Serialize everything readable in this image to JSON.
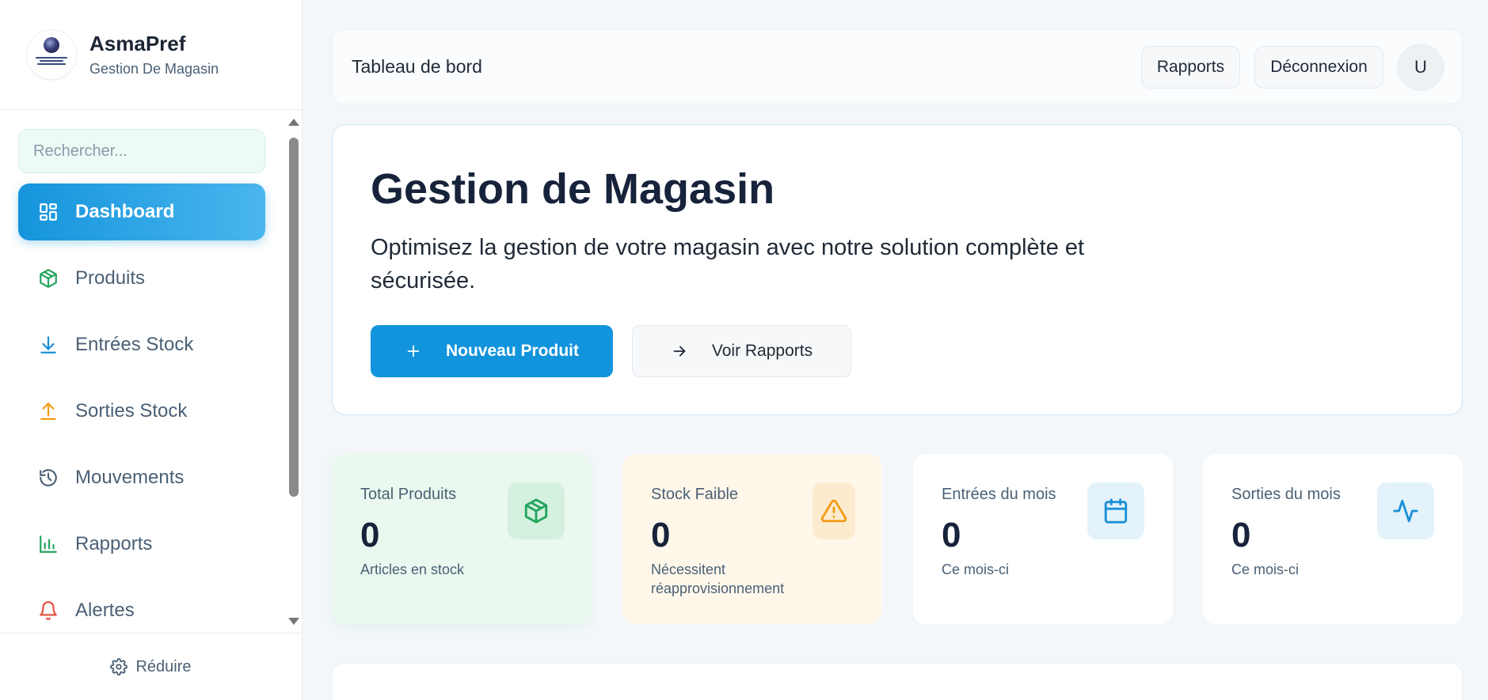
{
  "sidebar": {
    "brand_title": "AsmaPref",
    "brand_subtitle": "Gestion De Magasin",
    "search_placeholder": "Rechercher...",
    "items": [
      {
        "label": "Dashboard",
        "icon": "dashboard-icon",
        "active": true
      },
      {
        "label": "Produits",
        "icon": "package-icon",
        "color": "#22a45d"
      },
      {
        "label": "Entrées Stock",
        "icon": "download-icon",
        "color": "#1a8fd6"
      },
      {
        "label": "Sorties Stock",
        "icon": "upload-icon",
        "color": "#f39c12"
      },
      {
        "label": "Mouvements",
        "icon": "history-icon",
        "color": "#4a6075"
      },
      {
        "label": "Rapports",
        "icon": "bar-chart-icon",
        "color": "#22a45d"
      },
      {
        "label": "Alertes",
        "icon": "bell-icon",
        "color": "#e74c3c"
      }
    ],
    "footer_label": "Réduire"
  },
  "topbar": {
    "title": "Tableau de bord",
    "reports_label": "Rapports",
    "logout_label": "Déconnexion",
    "avatar_initial": "U"
  },
  "hero": {
    "title": "Gestion de Magasin",
    "description": "Optimisez la gestion de votre magasin avec notre solution complète et sécurisée.",
    "primary_label": "Nouveau Produit",
    "secondary_label": "Voir Rapports"
  },
  "stats": [
    {
      "label": "Total Produits",
      "value": "0",
      "sub": "Articles en stock",
      "icon": "package-icon",
      "accent": "#22a45d"
    },
    {
      "label": "Stock Faible",
      "value": "0",
      "sub": "Nécessitent réapprovisionnement",
      "icon": "warning-icon",
      "accent": "#f39c12"
    },
    {
      "label": "Entrées du mois",
      "value": "0",
      "sub": "Ce mois-ci",
      "icon": "calendar-icon",
      "accent": "#1a8fd6"
    },
    {
      "label": "Sorties du mois",
      "value": "0",
      "sub": "Ce mois-ci",
      "icon": "activity-icon",
      "accent": "#1a8fd6"
    }
  ],
  "colors": {
    "primary": "#1294dc",
    "background": "#f4f7fa",
    "text": "#17233a"
  }
}
